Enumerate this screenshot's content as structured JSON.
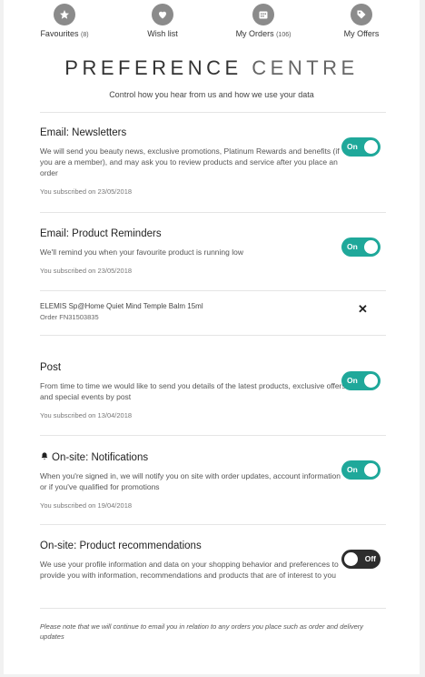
{
  "nav": {
    "favourites_label": "Favourites",
    "favourites_count": "(8)",
    "wishlist_label": "Wish list",
    "orders_label": "My Orders",
    "orders_count": "(106)",
    "offers_label": "My Offers"
  },
  "header": {
    "title_bold": "PREFERENCE",
    "title_light": "CENTRE",
    "subtitle": "Control how you hear from us and how we use your data"
  },
  "sections": [
    {
      "title": "Email: Newsletters",
      "description": "We will send you beauty news, exclusive promotions, Platinum Rewards and benefits (if you are a member), and may ask you to review products and service after you place an order",
      "date": "You subscribed on 23/05/2018",
      "toggle": "On"
    },
    {
      "title": "Email: Product Reminders",
      "description": "We'll remind you when your favourite product is running low",
      "date": "You subscribed on 23/05/2018",
      "toggle": "On"
    },
    {
      "title": "Post",
      "description": "From time to time we would like to send you details of the latest products, exclusive offers and special events by post",
      "date": "You subscribed on 13/04/2018",
      "toggle": "On"
    },
    {
      "title": "On-site: Notifications",
      "description": "When you're signed in, we will notify you on site with order updates, account information or if you've qualified for promotions",
      "date": "You subscribed on 19/04/2018",
      "toggle": "On"
    },
    {
      "title": "On-site: Product recommendations",
      "description": "We use your profile information and data on your shopping behavior and preferences to provide you with information, recommendations and products that are of interest to you",
      "toggle": "Off"
    }
  ],
  "reminder_product": {
    "name": "ELEMIS Sp@Home Quiet Mind Temple Balm 15ml",
    "order": "Order FN31503835",
    "remove_glyph": "✕"
  },
  "footnote": "Please note that we will continue to email you in relation to any orders you place such as order and delivery updates",
  "colors": {
    "toggle_on": "#1fa89a",
    "toggle_off": "#2d2d2d",
    "nav_icon_bg": "#8b8b8b"
  },
  "icons": [
    "star-icon",
    "heart-icon",
    "calendar-icon",
    "tag-icon",
    "bell-icon",
    "close-icon"
  ]
}
